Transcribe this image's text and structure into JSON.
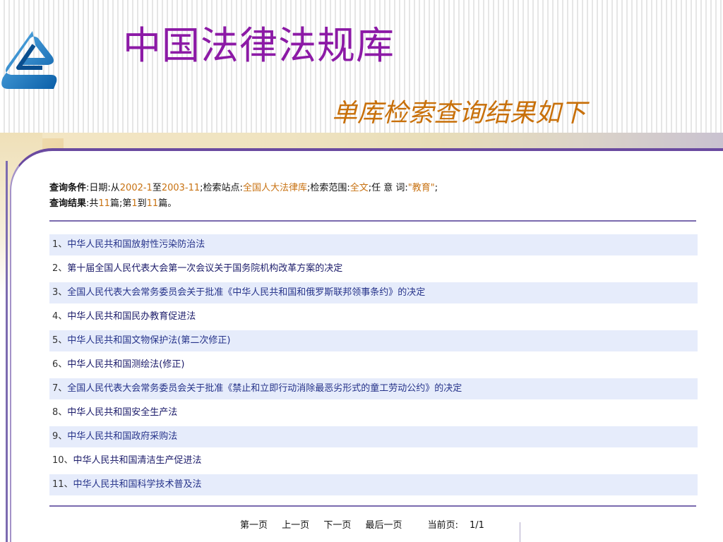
{
  "title": "中国法律法规库",
  "subtitle": "单库检索查询结果如下",
  "query": {
    "label": "查询条件",
    "date_label": ":日期:从",
    "date_from": "2002-1",
    "date_to_word": "至",
    "date_to": "2003-11",
    "station_label": ";检索站点:",
    "station": "全国人大法律库",
    "scope_label": ";检索范围:",
    "scope": "全文",
    "keyword_label": ";任 意 词:",
    "keyword": "\"教育\"",
    "end": ";"
  },
  "result_summary": {
    "label": "查询结果",
    "total_prefix": ":共",
    "total": "11",
    "total_suffix": "篇;第",
    "from": "1",
    "to_word": "到",
    "to": "11",
    "end": "篇。"
  },
  "results": [
    {
      "index": "1、",
      "title": "中华人民共和国放射性污染防治法"
    },
    {
      "index": "2、",
      "title": "第十届全国人民代表大会第一次会议关于国务院机构改革方案的决定"
    },
    {
      "index": "3、",
      "title": "全国人民代表大会常务委员会关于批准《中华人民共和国和俄罗斯联邦领事条约》的决定"
    },
    {
      "index": "4、",
      "title": "中华人民共和国民办教育促进法"
    },
    {
      "index": "5、",
      "title": "中华人民共和国文物保护法(第二次修正)"
    },
    {
      "index": "6、",
      "title": "中华人民共和国测绘法(修正)"
    },
    {
      "index": "7、",
      "title": "全国人民代表大会常务委员会关于批准《禁止和立即行动消除最恶劣形式的童工劳动公约》的决定"
    },
    {
      "index": "8、",
      "title": "中华人民共和国安全生产法"
    },
    {
      "index": "9、",
      "title": "中华人民共和国政府采购法"
    },
    {
      "index": "10、",
      "title": "中华人民共和国清洁生产促进法"
    },
    {
      "index": "11、",
      "title": "中华人民共和国科学技术普及法"
    }
  ],
  "pager": {
    "first": "第一页",
    "prev": "上一页",
    "next": "下一页",
    "last": "最后一页",
    "current_label": "当前页:",
    "current": "1/1"
  },
  "colors": {
    "title": "#8c1aa6",
    "subtitle": "#c8700a",
    "highlight": "#c87212",
    "accent": "#6a4aa0",
    "row_alt": "#e6ecfb"
  },
  "icons": {
    "logo": "stylized-e-logo"
  }
}
